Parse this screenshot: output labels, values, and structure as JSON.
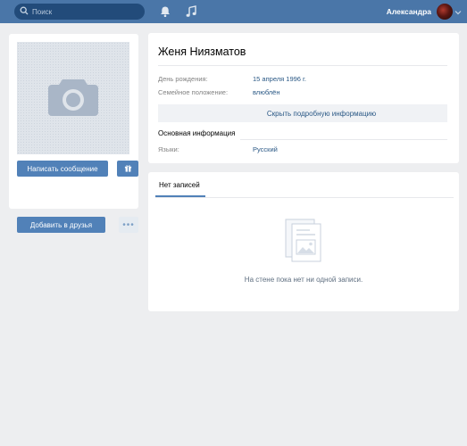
{
  "header": {
    "search_placeholder": "Поиск",
    "user_name": "Александра",
    "icons": [
      "search-icon",
      "bell-icon",
      "music-icon",
      "chevron-down-icon"
    ],
    "colors": {
      "bar": "#4a76a8",
      "search_bg": "#224b7a"
    }
  },
  "left": {
    "photo_icon": "camera-icon",
    "message_button": "Написать сообщение",
    "gift_icon": "gift-icon",
    "add_friend_button": "Добавить в друзья",
    "more_button": "•••"
  },
  "profile": {
    "name": "Женя Ниязматов",
    "birthday_label": "День рождения:",
    "birthday_value": "15 апреля 1996 г.",
    "family_label": "Семейное положение:",
    "family_value": "влюблён",
    "toggle_details": "Скрыть подробную информацию",
    "section_main": "Основная информация",
    "languages_label": "Языки:",
    "languages_value": "Русский"
  },
  "wall": {
    "tab": "Нет записей",
    "empty_icon": "empty-wall-icon",
    "empty_text": "На стене пока нет ни одной записи."
  },
  "colors": {
    "page_bg": "#edeef0",
    "button": "#5181b8",
    "link": "#2a5885"
  }
}
